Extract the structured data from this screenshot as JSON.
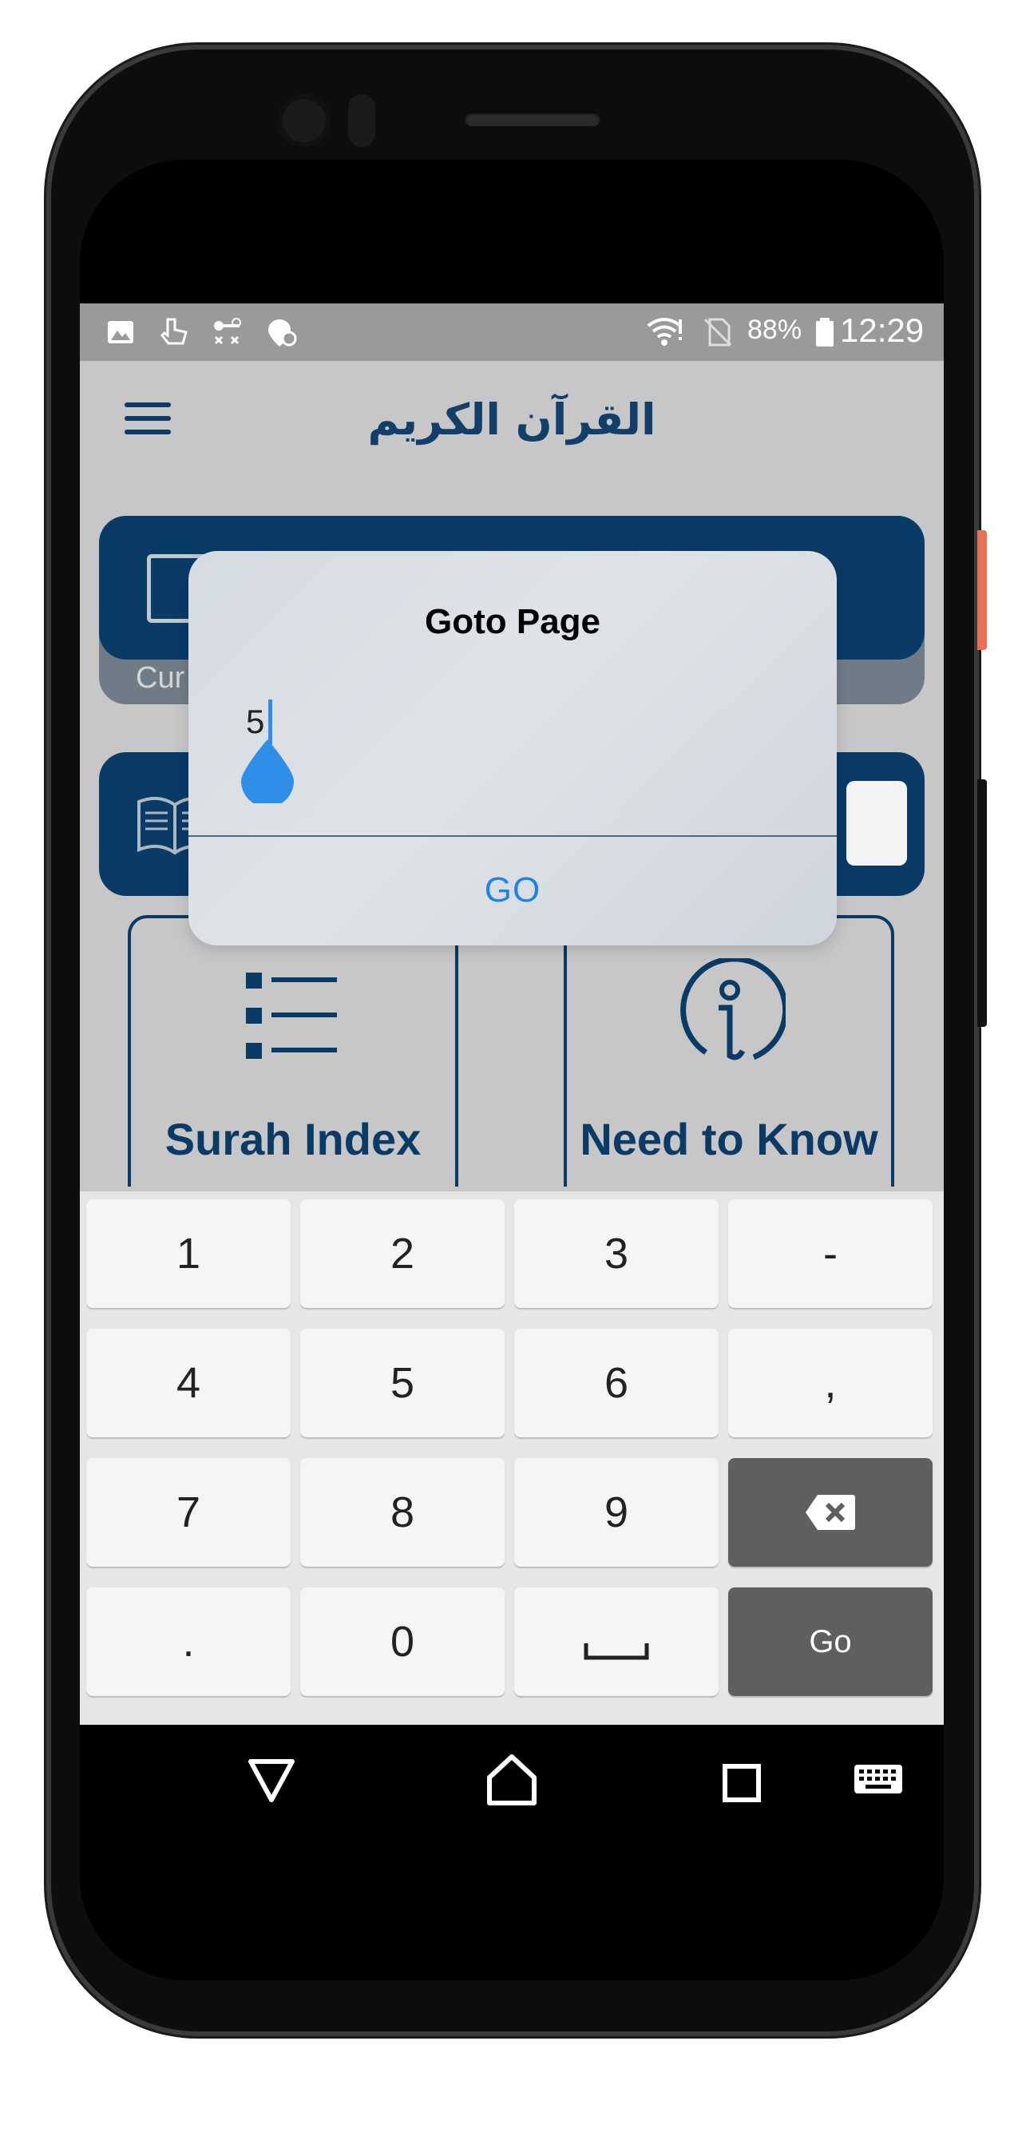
{
  "status_bar": {
    "left_icons": [
      "image-icon",
      "touch-icon",
      "voicemail-icon",
      "location-settings-icon"
    ],
    "battery_percent": "88%",
    "time": "12:29"
  },
  "app_bar": {
    "title": "القرآن الكريم",
    "menu_icon": "hamburger-menu-icon"
  },
  "background": {
    "card1_label": "Cur",
    "tile_surah_label": "Surah Index",
    "tile_know_label": "Need to Know"
  },
  "dialog": {
    "title": "Goto Page",
    "input_value": "5",
    "go_label": "GO"
  },
  "keyboard": {
    "rows": [
      [
        "1",
        "2",
        "3",
        "-"
      ],
      [
        "4",
        "5",
        "6",
        ","
      ],
      [
        "7",
        "8",
        "9",
        "⌫"
      ],
      [
        ".",
        "0",
        "␣",
        "Go"
      ]
    ]
  },
  "nav_bar": {
    "icons": [
      "back-triangle-icon",
      "home-icon",
      "recents-square-icon",
      "keyboard-icon"
    ]
  }
}
